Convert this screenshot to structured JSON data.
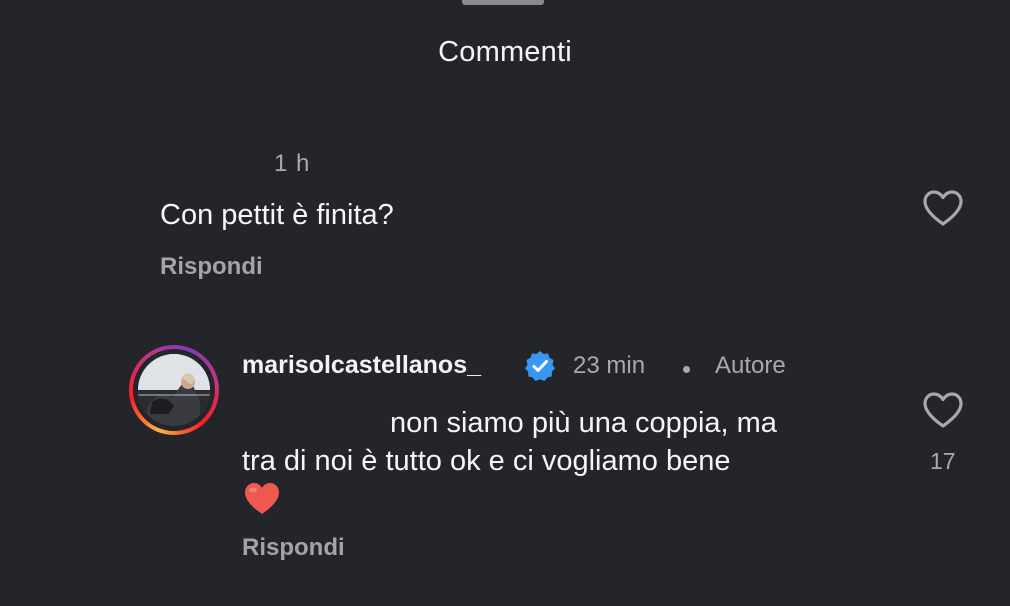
{
  "sheet": {
    "title": "Commenti"
  },
  "comments": [
    {
      "time": "1 h",
      "text": "Con pettit è finita?",
      "reply_label": "Rispondi",
      "like_icon": "heart-outline-icon"
    },
    {
      "username": "marisolcastellanos_",
      "verified": true,
      "time": "23 min",
      "separator": "•",
      "author_badge": "Autore",
      "text_line1": "non siamo più una coppia, ma",
      "text_line2": "tra di noi è tutto ok e ci vogliamo bene",
      "emoji": "red-heart",
      "reply_label": "Rispondi",
      "like_icon": "heart-outline-icon",
      "like_count": "17"
    }
  ],
  "colors": {
    "background": "#24252a",
    "secondary_text": "#a8a9ad",
    "verified_blue": "#3897f0",
    "heart_red": "#f0584f"
  }
}
